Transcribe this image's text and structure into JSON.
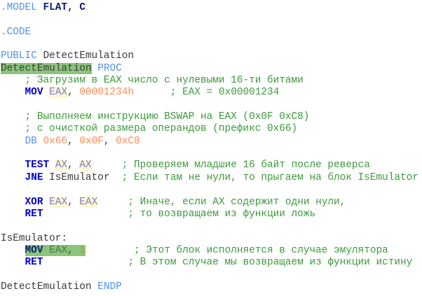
{
  "colors": {
    "directive": "#4f94e8",
    "keyword": "#0000cc",
    "register": "#7a7ae0",
    "register_highlight": "#fff8cc",
    "number": "#ff8c55",
    "comment": "#3d9a3d",
    "selection": "#8cc47c"
  },
  "lines": [
    [
      {
        "t": ".MODEL ",
        "c": "dir"
      },
      {
        "t": "FLAT, C",
        "c": "kwb"
      }
    ],
    [],
    [
      {
        "t": ".CODE",
        "c": "dir"
      }
    ],
    [],
    [
      {
        "t": "PUBLIC ",
        "c": "dir"
      },
      {
        "t": "DetectEmulation",
        "c": "plain"
      }
    ],
    [
      {
        "t": "DetectEmulation",
        "c": "plain sel"
      },
      {
        "t": " ",
        "c": "plain"
      },
      {
        "t": "PROC",
        "c": "dir"
      }
    ],
    [
      {
        "t": "    ",
        "c": "plain"
      },
      {
        "t": "; Загрузим в EAX число с нулевыми 16-ти битами",
        "c": "com"
      }
    ],
    [
      {
        "t": "    ",
        "c": "plain"
      },
      {
        "t": "MOV ",
        "c": "kw"
      },
      {
        "t": "EAX",
        "c": "reg"
      },
      {
        "t": ", ",
        "c": "plain"
      },
      {
        "t": "00001234h",
        "c": "num"
      },
      {
        "t": "      ",
        "c": "plain"
      },
      {
        "t": "; EAX = 0x00001234",
        "c": "com"
      }
    ],
    [],
    [
      {
        "t": "    ",
        "c": "plain"
      },
      {
        "t": "; Выполняем инструкцию BSWAP на EAX (0x0F 0xC8)",
        "c": "com"
      }
    ],
    [
      {
        "t": "    ",
        "c": "plain"
      },
      {
        "t": "; с очисткой размера операндов (префикс 0x66)",
        "c": "com"
      }
    ],
    [
      {
        "t": "    ",
        "c": "plain"
      },
      {
        "t": "DB ",
        "c": "dir"
      },
      {
        "t": "0x66",
        "c": "num"
      },
      {
        "t": ", ",
        "c": "plain"
      },
      {
        "t": "0x0F",
        "c": "num"
      },
      {
        "t": ", ",
        "c": "plain"
      },
      {
        "t": "0xC8",
        "c": "num"
      }
    ],
    [],
    [
      {
        "t": "    ",
        "c": "plain"
      },
      {
        "t": "TEST ",
        "c": "kw"
      },
      {
        "t": "AX",
        "c": "reg"
      },
      {
        "t": ", ",
        "c": "plain"
      },
      {
        "t": "AX",
        "c": "reg"
      },
      {
        "t": "     ",
        "c": "plain"
      },
      {
        "t": "; Проверяем младшие 16 байт после реверса",
        "c": "com"
      }
    ],
    [
      {
        "t": "    ",
        "c": "plain"
      },
      {
        "t": "JNE ",
        "c": "kw"
      },
      {
        "t": "IsEmulator",
        "c": "plain"
      },
      {
        "t": "  ",
        "c": "plain"
      },
      {
        "t": "; Если там не нули, то прыгаем на блок IsEmulator",
        "c": "com"
      }
    ],
    [],
    [
      {
        "t": "    ",
        "c": "plain"
      },
      {
        "t": "XOR ",
        "c": "kw"
      },
      {
        "t": "EAX",
        "c": "reg"
      },
      {
        "t": ", ",
        "c": "plain"
      },
      {
        "t": "EAX",
        "c": "reg"
      },
      {
        "t": "     ",
        "c": "plain"
      },
      {
        "t": "; Иначе, если AX содержит одни нули,",
        "c": "com"
      }
    ],
    [
      {
        "t": "    ",
        "c": "plain"
      },
      {
        "t": "RET",
        "c": "kw"
      },
      {
        "t": "              ",
        "c": "plain"
      },
      {
        "t": "; то возвращаем из функции ложь",
        "c": "com"
      }
    ],
    [],
    [
      {
        "t": "IsEmulator:",
        "c": "plain"
      }
    ],
    [
      {
        "t": "    ",
        "c": "plain"
      },
      {
        "t": "MOV ",
        "c": "kwb sel"
      },
      {
        "t": "EAX",
        "c": "reg sel"
      },
      {
        "t": ", ",
        "c": "plain sel"
      },
      {
        "t": "1",
        "c": "num sel"
      },
      {
        "t": "        ",
        "c": "plain"
      },
      {
        "t": "; Этот блок исполняется в случае эмулятора",
        "c": "com"
      }
    ],
    [
      {
        "t": "    ",
        "c": "plain"
      },
      {
        "t": "RET",
        "c": "kw"
      },
      {
        "t": "              ",
        "c": "plain"
      },
      {
        "t": "; В этом случае мы возвращаем из функции истину",
        "c": "com"
      }
    ],
    [],
    [
      {
        "t": "DetectEmulation ",
        "c": "plain"
      },
      {
        "t": "ENDP",
        "c": "dir"
      }
    ]
  ]
}
